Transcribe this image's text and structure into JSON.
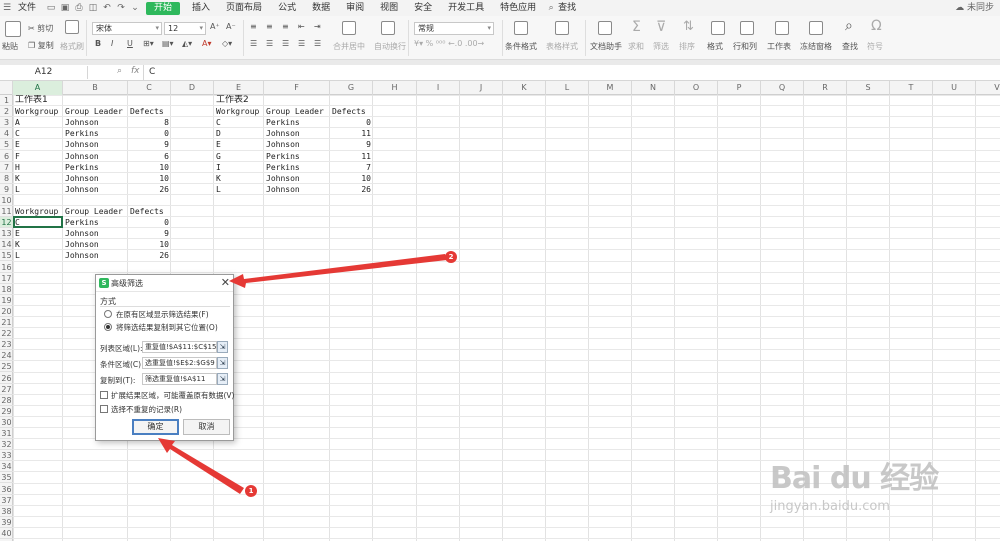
{
  "menubar": {
    "file": "文件",
    "tabs": [
      "开始",
      "插入",
      "页面布局",
      "公式",
      "数据",
      "审阅",
      "视图",
      "安全",
      "开发工具",
      "特色应用"
    ],
    "active_tab": "开始",
    "search": "查找",
    "sync": "未同步"
  },
  "ribbon": {
    "paste": "粘贴",
    "cut": "剪切",
    "copy": "复制",
    "format_painter": "格式刷",
    "font_name": "宋体",
    "font_size": "12",
    "bold": "B",
    "italic": "I",
    "underline": "U",
    "merge_center": "合并居中",
    "wrap_text": "自动换行",
    "number_format": "常规",
    "conditional_format": "条件格式",
    "table_style": "表格样式",
    "doc_assistant": "文档助手",
    "sum": "求和",
    "filter": "筛选",
    "sort": "排序",
    "format": "格式",
    "row_col": "行和列",
    "worksheet": "工作表",
    "freeze": "冻结窗格",
    "find": "查找",
    "symbol": "符号"
  },
  "formulabar": {
    "cell_ref": "A12",
    "content": "C"
  },
  "columns": [
    "A",
    "B",
    "C",
    "D",
    "E",
    "F",
    "G",
    "H",
    "I",
    "J",
    "K",
    "L",
    "M",
    "N",
    "O",
    "P",
    "Q",
    "R",
    "S",
    "T",
    "U",
    "V"
  ],
  "rows": [
    "1",
    "2",
    "3",
    "4",
    "5",
    "6",
    "7",
    "8",
    "9",
    "10",
    "11",
    "12",
    "13",
    "14",
    "15",
    "16",
    "17",
    "18",
    "19",
    "20",
    "21",
    "22",
    "23",
    "24",
    "25",
    "26",
    "27",
    "28",
    "29",
    "30",
    "31",
    "32",
    "33",
    "34",
    "35",
    "36",
    "37",
    "38",
    "39",
    "40"
  ],
  "sheet": {
    "title1": "工作表1",
    "title2": "工作表2",
    "table1": {
      "headers": [
        "Workgroup",
        "Group Leader",
        "Defects"
      ],
      "rows": [
        [
          "A",
          "Johnson",
          "8"
        ],
        [
          "C",
          "Perkins",
          "0"
        ],
        [
          "E",
          "Johnson",
          "9"
        ],
        [
          "F",
          "Johnson",
          "6"
        ],
        [
          "H",
          "Perkins",
          "10"
        ],
        [
          "K",
          "Johnson",
          "10"
        ],
        [
          "L",
          "Johnson",
          "26"
        ]
      ]
    },
    "table2": {
      "headers": [
        "Workgroup",
        "Group Leader",
        "Defects"
      ],
      "rows": [
        [
          "C",
          "Perkins",
          "0"
        ],
        [
          "D",
          "Johnson",
          "11"
        ],
        [
          "E",
          "Johnson",
          "9"
        ],
        [
          "G",
          "Perkins",
          "11"
        ],
        [
          "I",
          "Perkins",
          "7"
        ],
        [
          "K",
          "Johnson",
          "10"
        ],
        [
          "L",
          "Johnson",
          "26"
        ]
      ]
    },
    "result": {
      "headers": [
        "Workgroup",
        "Group Leader",
        "Defects"
      ],
      "rows": [
        [
          "C",
          "Perkins",
          "0"
        ],
        [
          "E",
          "Johnson",
          "9"
        ],
        [
          "K",
          "Johnson",
          "10"
        ],
        [
          "L",
          "Johnson",
          "26"
        ]
      ]
    }
  },
  "dialog": {
    "title": "高级筛选",
    "section": "方式",
    "option1": "在原有区域显示筛选结果(F)",
    "option2": "将筛选结果复制到其它位置(O)",
    "list_range_label": "列表区域(L):",
    "list_range_value": "重复值!$A$11:$C$15",
    "criteria_label": "条件区域(C):",
    "criteria_value": "选重复值!$E$2:$G$9",
    "copy_to_label": "复制到(T):",
    "copy_to_value": "筛选重复值!$A$11",
    "expand_label": "扩展结果区域，可能覆盖原有数据(V)",
    "unique_label": "选择不重复的记录(R)",
    "ok": "确定",
    "cancel": "取消"
  },
  "annotations": {
    "badge1": "1",
    "badge2": "2"
  },
  "watermark": {
    "logo": "Bai du 经验",
    "url": "jingyan.baidu.com"
  }
}
